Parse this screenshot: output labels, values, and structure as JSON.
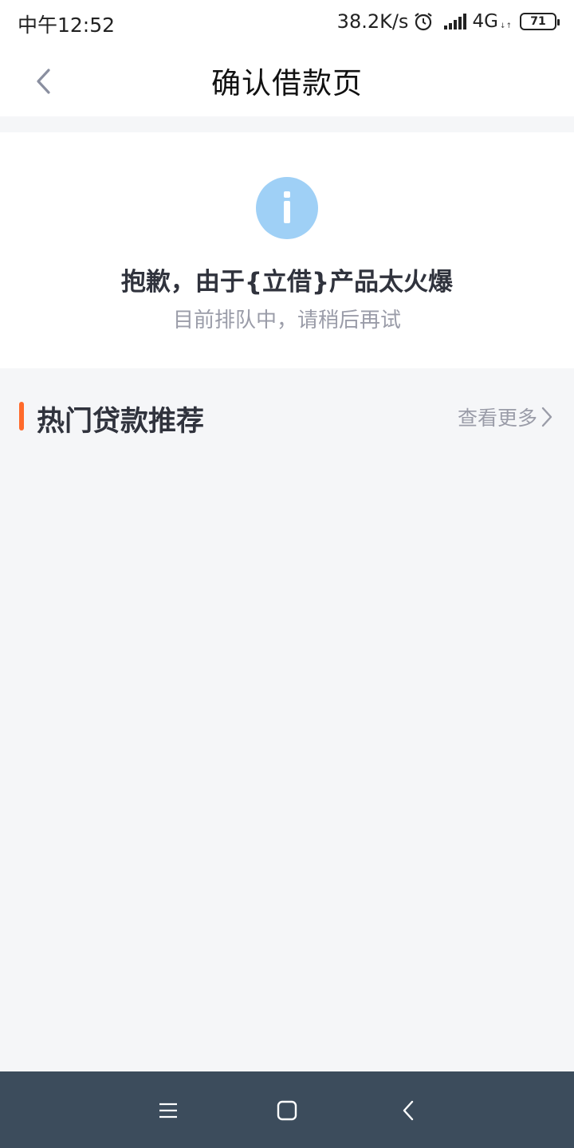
{
  "status_bar": {
    "time": "中午12:52",
    "speed": "38.2K/s",
    "network": "4G",
    "network_sub": "↓↑",
    "battery": "71",
    "icons": [
      "alarm-icon",
      "signal-icon",
      "battery-icon"
    ]
  },
  "nav": {
    "title": "确认借款页",
    "back_icon": "back-arrow-icon"
  },
  "notice": {
    "icon": "info-icon",
    "icon_color": "#9fd0f6",
    "title": "抱歉，由于{立借}产品太火爆",
    "subtitle": "目前排队中，请稍后再试"
  },
  "section": {
    "title": "热门贷款推荐",
    "accent_color": "#ff6a2b",
    "see_more": "查看更多",
    "see_more_icon": "chevron-right-icon"
  },
  "system_nav": {
    "icons": [
      "menu-icon",
      "home-icon",
      "back-icon"
    ]
  }
}
